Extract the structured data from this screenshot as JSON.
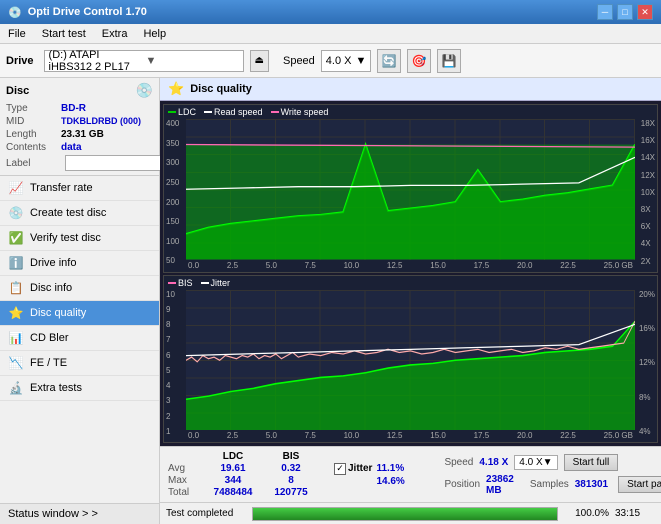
{
  "app": {
    "title": "Opti Drive Control 1.70",
    "icon": "💿"
  },
  "titlebar": {
    "minimize": "─",
    "maximize": "□",
    "close": "✕"
  },
  "menubar": {
    "items": [
      "File",
      "Start test",
      "Extra",
      "Help"
    ]
  },
  "toolbar": {
    "drive_label": "Drive",
    "drive_value": "(D:) ATAPI iHBS312  2 PL17",
    "eject_icon": "⏏",
    "speed_label": "Speed",
    "speed_value": "4.0 X",
    "icons": [
      "🔄",
      "🎯",
      "💾"
    ]
  },
  "sidebar": {
    "disc_section": {
      "title": "Disc",
      "type_label": "Type",
      "type_value": "BD-R",
      "mid_label": "MID",
      "mid_value": "TDKBLDRBD (000)",
      "length_label": "Length",
      "length_value": "23.31 GB",
      "contents_label": "Contents",
      "contents_value": "data",
      "label_label": "Label",
      "label_value": ""
    },
    "nav_items": [
      {
        "id": "transfer-rate",
        "label": "Transfer rate",
        "icon": "📈"
      },
      {
        "id": "create-test-disc",
        "label": "Create test disc",
        "icon": "💿"
      },
      {
        "id": "verify-test-disc",
        "label": "Verify test disc",
        "icon": "✅"
      },
      {
        "id": "drive-info",
        "label": "Drive info",
        "icon": "ℹ️"
      },
      {
        "id": "disc-info",
        "label": "Disc info",
        "icon": "📋"
      },
      {
        "id": "disc-quality",
        "label": "Disc quality",
        "icon": "⭐",
        "active": true
      },
      {
        "id": "cd-bler",
        "label": "CD Bler",
        "icon": "📊"
      },
      {
        "id": "fe-te",
        "label": "FE / TE",
        "icon": "📉"
      },
      {
        "id": "extra-tests",
        "label": "Extra tests",
        "icon": "🔬"
      }
    ],
    "status_window": "Status window > >"
  },
  "chart": {
    "title": "Disc quality",
    "top": {
      "legends": [
        "LDC",
        "Read speed",
        "Write speed"
      ],
      "legend_colors": [
        "#00cc00",
        "#ffffff",
        "#ff69b4"
      ],
      "y_left": [
        "400",
        "350",
        "300",
        "250",
        "200",
        "150",
        "100",
        "50"
      ],
      "y_right": [
        "18X",
        "16X",
        "14X",
        "12X",
        "10X",
        "8X",
        "6X",
        "4X",
        "2X"
      ],
      "x_labels": [
        "0.0",
        "2.5",
        "5.0",
        "7.5",
        "10.0",
        "12.5",
        "15.0",
        "17.5",
        "20.0",
        "22.5",
        "25.0 GB"
      ]
    },
    "bottom": {
      "legends": [
        "BIS",
        "Jitter"
      ],
      "legend_colors": [
        "#ff69b4",
        "#ffffff"
      ],
      "y_left": [
        "10",
        "9",
        "8",
        "7",
        "6",
        "5",
        "4",
        "3",
        "2",
        "1"
      ],
      "y_right": [
        "20%",
        "16%",
        "12%",
        "8%",
        "4%"
      ],
      "x_labels": [
        "0.0",
        "2.5",
        "5.0",
        "7.5",
        "10.0",
        "12.5",
        "15.0",
        "17.5",
        "20.0",
        "22.5",
        "25.0 GB"
      ]
    }
  },
  "stats": {
    "headers": [
      "",
      "LDC",
      "BIS",
      "",
      "Jitter",
      "Speed",
      ""
    ],
    "avg_label": "Avg",
    "avg_ldc": "19.61",
    "avg_bis": "0.32",
    "avg_jitter": "11.1%",
    "max_label": "Max",
    "max_ldc": "344",
    "max_bis": "8",
    "max_jitter": "14.6%",
    "total_label": "Total",
    "total_ldc": "7488484",
    "total_bis": "120775",
    "position_label": "Position",
    "position_val": "23862 MB",
    "samples_label": "Samples",
    "samples_val": "381301",
    "speed_label": "Speed",
    "speed_val": "4.18 X",
    "speed_select": "4.0 X",
    "btn_full": "Start full",
    "btn_part": "Start part",
    "jitter_label": "Jitter"
  },
  "progress": {
    "label": "Test completed",
    "percent": 100,
    "percent_text": "100.0%",
    "time": "33:15"
  }
}
